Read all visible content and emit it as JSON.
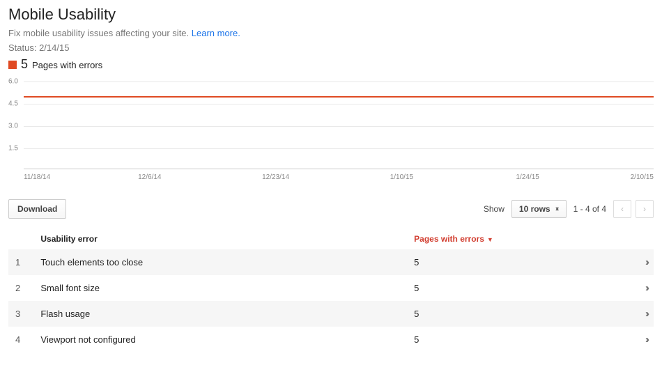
{
  "header": {
    "title": "Mobile Usability",
    "subtitle_prefix": "Fix mobile usability issues affecting your site. ",
    "learn_more": "Learn more.",
    "status_label": "Status: ",
    "status_value": "2/14/15",
    "summary_count": "5",
    "summary_label": "Pages with errors"
  },
  "chart_data": {
    "type": "line",
    "title": "",
    "xlabel": "",
    "ylabel": "",
    "ylim": [
      0,
      6
    ],
    "y_ticks": [
      "1.5",
      "3.0",
      "4.5",
      "6.0"
    ],
    "categories": [
      "11/18/14",
      "12/6/14",
      "12/23/14",
      "1/10/15",
      "1/24/15",
      "2/10/15"
    ],
    "series": [
      {
        "name": "Pages with errors",
        "color": "#e04a23",
        "const_value": 5
      }
    ]
  },
  "controls": {
    "download": "Download",
    "show_label": "Show",
    "rows_select": "10 rows",
    "range_text": "1 - 4 of 4"
  },
  "table": {
    "columns": {
      "idx": "",
      "error": "Usability error",
      "pages": "Pages with errors"
    },
    "rows": [
      {
        "idx": "1",
        "error": "Touch elements too close",
        "pages": "5"
      },
      {
        "idx": "2",
        "error": "Small font size",
        "pages": "5"
      },
      {
        "idx": "3",
        "error": "Flash usage",
        "pages": "5"
      },
      {
        "idx": "4",
        "error": "Viewport not configured",
        "pages": "5"
      }
    ]
  }
}
